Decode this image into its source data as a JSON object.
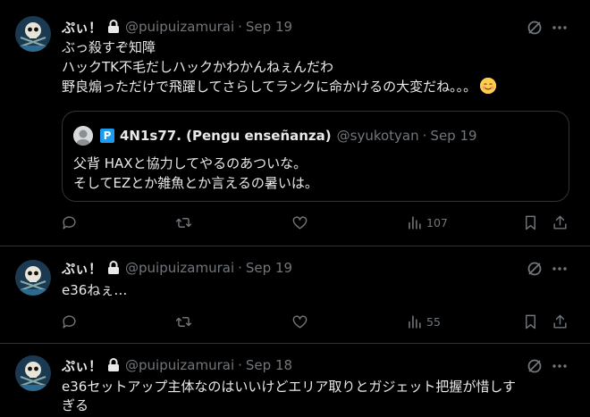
{
  "tweets": [
    {
      "name": "ぷぃ！",
      "handle": "@puipuizamurai",
      "date": "Sep 19",
      "lines": [
        "ぶっ殺すぞ知障",
        "ハックTK不毛だしハックかわかんねぇんだわ",
        "野良煽っただけで飛躍してさらしてランクに命かけるの大変だね。。。"
      ],
      "emoji": "relieved-face-emoji",
      "views": "107",
      "quote": {
        "name": "4N1s77. (Pengu enseñanza)",
        "handle": "@syukotyan",
        "date": "Sep 19",
        "badge": "P",
        "lines": [
          "父背 HAXと協力してやるのあついな。",
          "そしてEZとか雑魚とか言えるの暑いは。"
        ]
      }
    },
    {
      "name": "ぷぃ！",
      "handle": "@puipuizamurai",
      "date": "Sep 19",
      "lines": [
        "e36ねぇ…"
      ],
      "views": "55"
    },
    {
      "name": "ぷぃ！",
      "handle": "@puipuizamurai",
      "date": "Sep 18",
      "lines": [
        "e36セットアップ主体なのはいいけどエリア取りとガジェット把握が惜しす",
        "ぎる"
      ]
    }
  ],
  "separator": "·",
  "colors": {
    "background": "#000000",
    "text": "#e7e9ea",
    "muted": "#71767b",
    "border": "#2f3336",
    "accent": "#1d9bf0"
  },
  "icons": [
    "lock-icon",
    "grok-icon",
    "more-icon",
    "reply-icon",
    "retweet-icon",
    "like-icon",
    "views-icon",
    "bookmark-icon",
    "share-icon"
  ]
}
